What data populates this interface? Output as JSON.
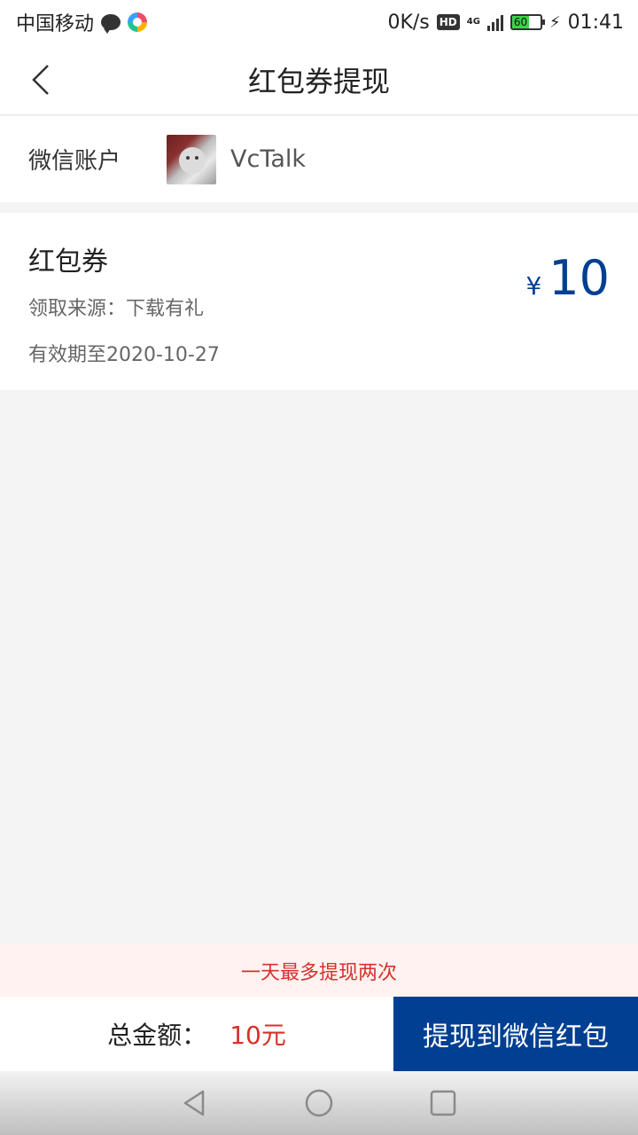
{
  "status_bar": {
    "carrier": "中国移动",
    "net_speed": "0K/s",
    "hd": "HD",
    "network": "4G",
    "battery": "60",
    "time": "01:41"
  },
  "header": {
    "title": "红包券提现"
  },
  "account": {
    "label": "微信账户",
    "name": "VcTalk"
  },
  "coupon": {
    "title": "红包券",
    "source": "领取来源：下载有礼",
    "expiry": "有效期至2020-10-27",
    "currency": "¥",
    "amount": "10",
    "amount_color": "#003f91"
  },
  "notice": {
    "text": "一天最多提现两次"
  },
  "footer": {
    "total_label": "总金额：",
    "total_value": "10元",
    "withdraw_button": "提现到微信红包",
    "accent_color": "#003f91",
    "highlight_color": "#d6312b"
  },
  "system_nav": {
    "icons": [
      "back-triangle-icon",
      "home-circle-icon",
      "recents-square-icon"
    ]
  }
}
